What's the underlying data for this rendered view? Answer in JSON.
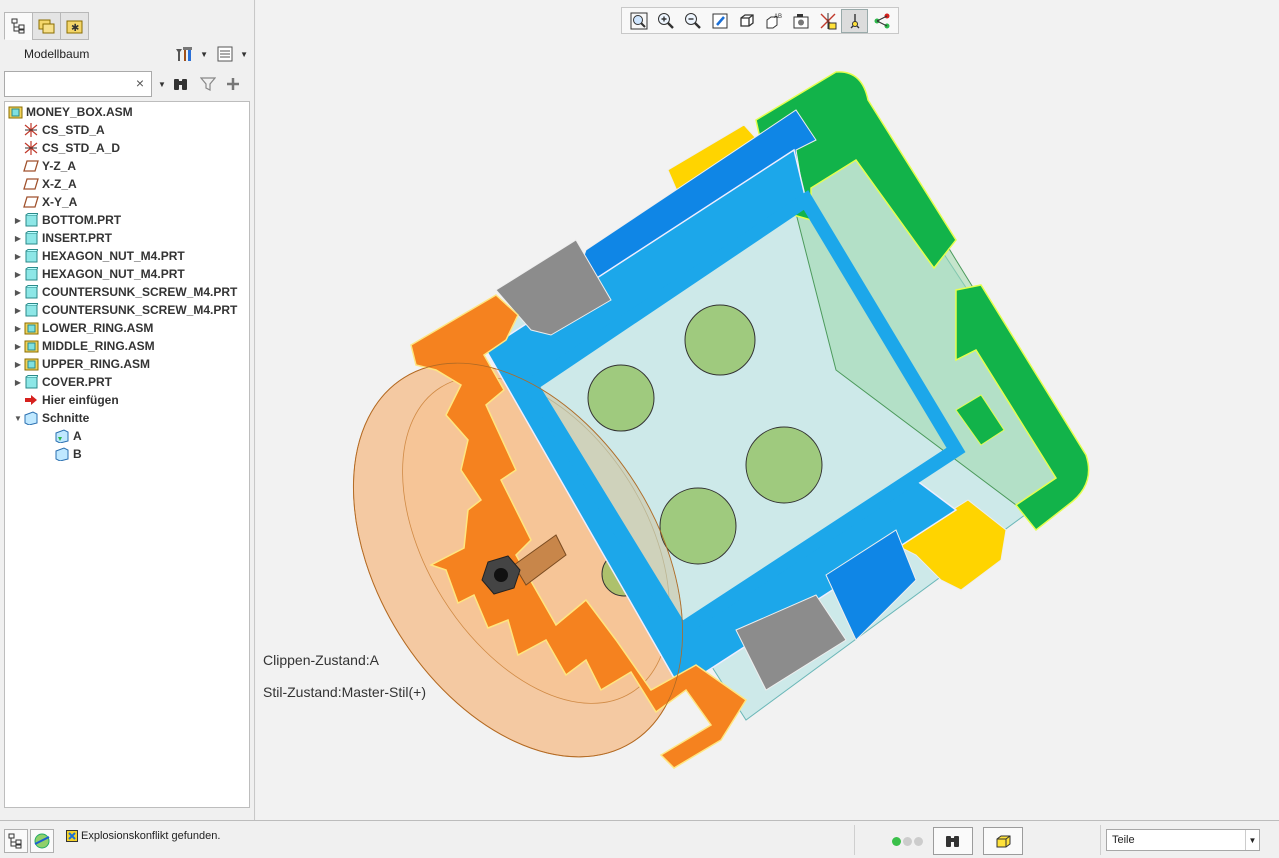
{
  "panel": {
    "title": "Modellbaum",
    "search_value": "",
    "search_clear": "×"
  },
  "tree": [
    {
      "label": "MONEY_BOX.ASM",
      "icon": "assembly-icon",
      "depth": 0,
      "expander": ""
    },
    {
      "label": "CS_STD_A",
      "icon": "coordinate-system-icon",
      "depth": 1,
      "expander": ""
    },
    {
      "label": "CS_STD_A_D",
      "icon": "coordinate-system-icon",
      "depth": 1,
      "expander": ""
    },
    {
      "label": "Y-Z_A",
      "icon": "datum-plane-icon",
      "depth": 1,
      "expander": ""
    },
    {
      "label": "X-Z_A",
      "icon": "datum-plane-icon",
      "depth": 1,
      "expander": ""
    },
    {
      "label": "X-Y_A",
      "icon": "datum-plane-icon",
      "depth": 1,
      "expander": ""
    },
    {
      "label": "BOTTOM.PRT",
      "icon": "part-icon",
      "depth": 1,
      "expander": "▶"
    },
    {
      "label": "INSERT.PRT",
      "icon": "part-icon",
      "depth": 1,
      "expander": "▶"
    },
    {
      "label": "HEXAGON_NUT_M4.PRT",
      "icon": "part-icon",
      "depth": 1,
      "expander": "▶"
    },
    {
      "label": "HEXAGON_NUT_M4.PRT",
      "icon": "part-icon",
      "depth": 1,
      "expander": "▶"
    },
    {
      "label": "COUNTERSUNK_SCREW_M4.PRT",
      "icon": "part-icon",
      "depth": 1,
      "expander": "▶"
    },
    {
      "label": "COUNTERSUNK_SCREW_M4.PRT",
      "icon": "part-icon",
      "depth": 1,
      "expander": "▶"
    },
    {
      "label": "LOWER_RING.ASM",
      "icon": "assembly-icon",
      "depth": 1,
      "expander": "▶"
    },
    {
      "label": "MIDDLE_RING.ASM",
      "icon": "assembly-icon",
      "depth": 1,
      "expander": "▶"
    },
    {
      "label": "UPPER_RING.ASM",
      "icon": "assembly-icon",
      "depth": 1,
      "expander": "▶"
    },
    {
      "label": "COVER.PRT",
      "icon": "part-icon",
      "depth": 1,
      "expander": "▶"
    },
    {
      "label": "Hier einfügen",
      "icon": "insert-here-arrow-icon",
      "depth": 1,
      "expander": ""
    },
    {
      "label": "Schnitte",
      "icon": "sections-icon",
      "depth": 1,
      "expander": "▼"
    },
    {
      "label": "A",
      "icon": "section-active-icon",
      "depth": 2,
      "expander": ""
    },
    {
      "label": "B",
      "icon": "section-icon",
      "depth": 2,
      "expander": ""
    }
  ],
  "viewport": {
    "clip_state": "Clippen-Zustand:A",
    "style_state": "Stil-Zustand:Master-Stil(+)",
    "toolbar": [
      "refit-icon",
      "zoom-in-icon",
      "zoom-out-icon",
      "repaint-icon",
      "display-style-icon",
      "saved-orientations-icon",
      "view-manager-icon",
      "datum-display-icon",
      "spin-center-icon",
      "annotation-display-icon"
    ]
  },
  "statusbar": {
    "message": "Explosionskonflikt gefunden.",
    "filter": "Teile"
  },
  "colors": {
    "orange": "#f5821f",
    "blue": "#1ca7ea",
    "green": "#12b34a",
    "yellow": "#ffd400",
    "gray": "#8c8c8c"
  }
}
